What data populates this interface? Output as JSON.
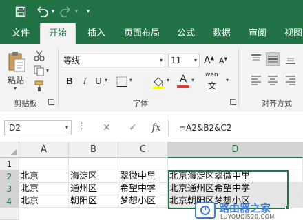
{
  "quick_access": {
    "save_icon": "save-icon",
    "undo_icon": "undo-icon",
    "redo_icon": "redo-icon",
    "customize_icon": "chevron-down-icon"
  },
  "tabs": [
    "文件",
    "开始",
    "插入",
    "页面布局",
    "公式",
    "数据",
    "审阅",
    "视图"
  ],
  "active_tab": "开始",
  "ribbon": {
    "paste_label": "粘贴",
    "clipboard_group": "剪贴板",
    "font_group": "字体",
    "alignment_group": "对齐方式",
    "font_name": "等线",
    "font_size": "11",
    "bold": "B",
    "italic": "I",
    "underline": "U",
    "font_grow": "A",
    "font_shrink": "A",
    "font_color_label": "A",
    "phonetic_label": "wén"
  },
  "formula_bar": {
    "name_box": "D2",
    "cancel": "✕",
    "enter": "✓",
    "fx": "fx",
    "formula": "=A2&B2&C2"
  },
  "grid": {
    "columns": [
      "A",
      "B",
      "C",
      "D"
    ],
    "rows": [
      {
        "num": "1",
        "cells": [
          "",
          "",
          "",
          ""
        ]
      },
      {
        "num": "2",
        "cells": [
          "北京",
          "海淀区",
          "翠微中里",
          "北京海淀区翠微中里"
        ]
      },
      {
        "num": "3",
        "cells": [
          "北京",
          "通州区",
          "希望中学",
          "北京通州区希望中学"
        ]
      },
      {
        "num": "4",
        "cells": [
          "北京",
          "朝阳区",
          "梦想小区",
          "北京朝阳区梦想小区"
        ]
      }
    ],
    "selected_cell": "D2"
  },
  "watermark": {
    "title": "路由器之家",
    "subtitle": "LUYOUQI520.COM"
  },
  "colors": {
    "accent": "#217346",
    "ribbon_bg": "#f3f3f3",
    "highlight_yellow": "#ffff00",
    "font_red": "#e03c31"
  }
}
